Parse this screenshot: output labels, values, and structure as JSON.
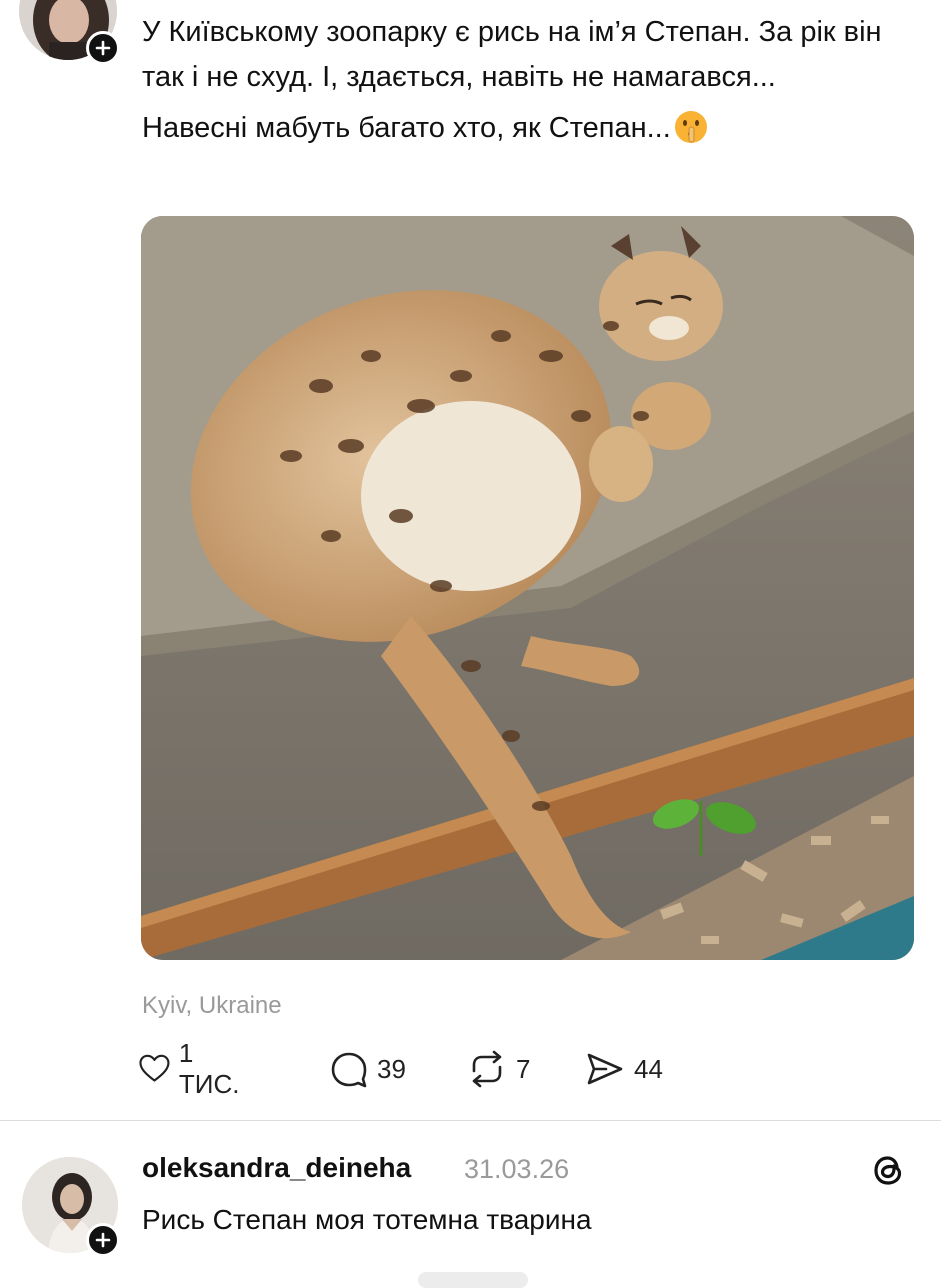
{
  "post": {
    "text_line1": "У Київському зоопарку є рись на ім’я Степан. За рік він так і не схуд. І, здається, навіть не намагався...",
    "text_line2": "Навесні мабуть багато хто, як Степан...",
    "emoji": "shushing-face-emoji",
    "location": "Kyiv, Ukraine",
    "actions": {
      "likes": "1 ТИС.",
      "comments": "39",
      "reposts": "7",
      "shares": "44"
    }
  },
  "reply": {
    "username": "oleksandra_deineha",
    "date": "31.03.26",
    "text": "Рись Степан моя тотемна тварина"
  },
  "icons": {
    "like": "heart-icon",
    "comment": "comment-bubble-icon",
    "repost": "repost-icon",
    "share": "share-send-icon",
    "app": "threads-logo-icon",
    "follow": "plus-icon"
  },
  "colors": {
    "text": "#111111",
    "muted": "#9a9a9a",
    "badge": "#111111"
  }
}
